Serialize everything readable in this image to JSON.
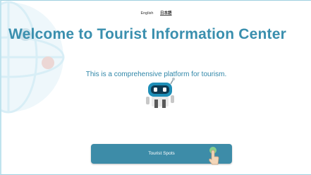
{
  "language_switcher": {
    "english_label": "English",
    "japanese_label": "日本語"
  },
  "hero": {
    "title": "Welcome to Tourist Information Center",
    "subtitle": "This is a comprehensive platform for tourism."
  },
  "actions": {
    "tourist_spots_label": "Tourist Spots"
  },
  "colors": {
    "accent": "#3a8fae",
    "button": "#3d8ca8",
    "mascot_head": "#1f8fb8"
  },
  "icons": {
    "mascot": "robot-mascot-icon",
    "pointer": "hand-pointer-icon",
    "background": "globe-background-icon"
  }
}
